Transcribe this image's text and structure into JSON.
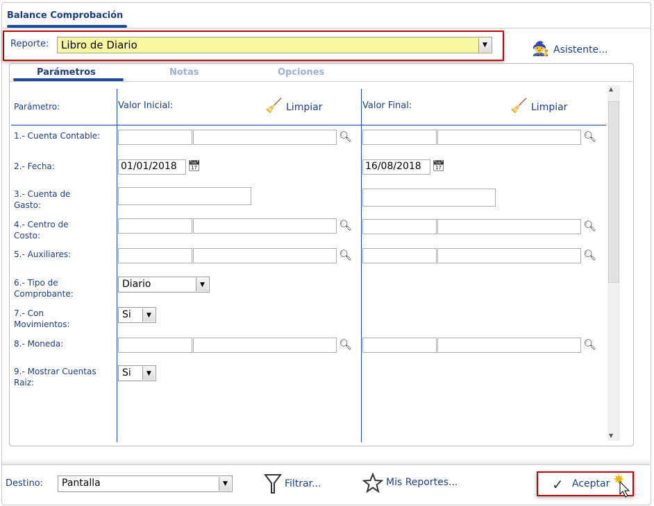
{
  "tab": "Balance Comprobación",
  "report": {
    "label": "Reporte:",
    "value": "Libro de Diario"
  },
  "wizard": "Asistente...",
  "subtabs": [
    "Parámetros",
    "Notas",
    "Opciones"
  ],
  "headers": {
    "param": "Parámetro:",
    "initial": "Valor Inicial:",
    "final": "Valor Final:",
    "clear": "Limpiar"
  },
  "rows": [
    {
      "label": "1.- Cuenta Contable:"
    },
    {
      "label": "2.- Fecha:",
      "initial": "01/01/2018",
      "final": "16/08/2018"
    },
    {
      "label": "3.- Cuenta de Gasto:"
    },
    {
      "label": "4.- Centro de Costo:"
    },
    {
      "label": "5.- Auxiliares:"
    },
    {
      "label": "6.- Tipo de Comprobante:",
      "value": "Diario"
    },
    {
      "label": "7.- Con Movimientos:",
      "value": "Si"
    },
    {
      "label": "8.- Moneda:"
    },
    {
      "label": "9.- Mostrar Cuentas Raiz:",
      "value": "Si"
    }
  ],
  "footer": {
    "dest_label": "Destino:",
    "dest_value": "Pantalla",
    "filter": "Filtrar...",
    "my_reports": "Mis Reportes...",
    "accept": "Aceptar"
  }
}
